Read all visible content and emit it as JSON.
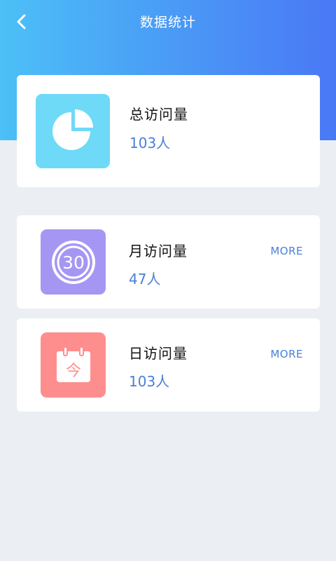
{
  "header": {
    "title": "数据统计",
    "back_icon": "chevron-left-icon"
  },
  "colors": {
    "header_gradient_start": "#4cc0f7",
    "header_gradient_end": "#4a78f5",
    "background": "#ebeef3",
    "value_text": "#4a7fd8",
    "total_icon_bg": "#6fd9f8",
    "month_icon_bg": "#a696f4",
    "today_icon_bg": "#fe8e8e"
  },
  "stats": {
    "total": {
      "label": "总访问量",
      "value": "103人",
      "icon": "pie-chart-icon"
    },
    "month": {
      "label": "月访问量",
      "value": "47人",
      "icon": "thirty-days-icon",
      "icon_text": "30",
      "more": "MORE"
    },
    "today": {
      "label": "日访问量",
      "value": "103人",
      "icon": "calendar-today-icon",
      "icon_text": "今",
      "more": "MORE"
    }
  }
}
